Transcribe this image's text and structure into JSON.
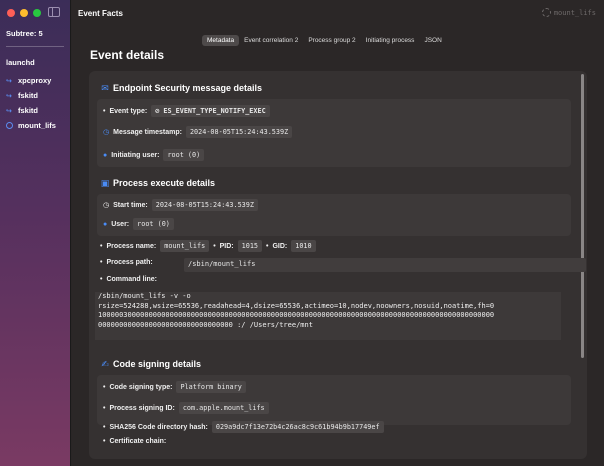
{
  "sidebar": {
    "subtree_label": "Subtree: 5",
    "root": "launchd",
    "items": [
      {
        "label": "xpcproxy",
        "icon": "arrow-icon"
      },
      {
        "label": "fskitd",
        "icon": "arrow-icon"
      },
      {
        "label": "fskitd",
        "icon": "arrow-icon"
      },
      {
        "label": "mount_lifs",
        "icon": "circle-icon"
      }
    ]
  },
  "window": {
    "title": "Event Facts",
    "titlebar_right": "mount_lifs"
  },
  "tabs": [
    {
      "label": "Metadata",
      "active": true
    },
    {
      "label": "Event correlation 2",
      "active": false
    },
    {
      "label": "Process group 2",
      "active": false
    },
    {
      "label": "Initiating process",
      "active": false
    },
    {
      "label": "JSON",
      "active": false
    }
  ],
  "page_title": "Event details",
  "es_section": {
    "title": "Endpoint Security message details",
    "event_type_label": "Event type:",
    "event_type_value": "ES_EVENT_TYPE_NOTIFY_EXEC",
    "timestamp_label": "Message timestamp:",
    "timestamp_value": "2024-08-05T15:24:43.539Z",
    "user_label": "Initiating user:",
    "user_value": "root (0)"
  },
  "proc_section": {
    "title": "Process execute details",
    "start_label": "Start time:",
    "start_value": "2024-08-05T15:24:43.539Z",
    "user_label": "User:",
    "user_value": "root (0)",
    "name_label": "Process name:",
    "name_value": "mount_lifs",
    "pid_label": "PID:",
    "pid_value": "1015",
    "gid_label": "GID:",
    "gid_value": "1010",
    "path_label": "Process path:",
    "path_value": "/sbin/mount_lifs",
    "cmd_label": "Command line:",
    "cmd_value": "/sbin/mount_lifs -v -o\nrsize=524288,wsize=65536,readahead=4,dsize=65536,actimeo=10,nodev,noowners,nosuid,noatime,fh=0\n1000003000000000000000000000000000000000000000000000000000000000000000000000000000000000000000\n00000000000000000000000000000000 :/ /Users/tree/mnt"
  },
  "cs_section": {
    "title": "Code signing details",
    "type_label": "Code signing type:",
    "type_value": "Platform binary",
    "id_label": "Process signing ID:",
    "id_value": "com.apple.mount_lifs",
    "hash_label": "SHA256 Code directory hash:",
    "hash_value": "029a9dc7f13e72b4c26ac8c9c61b94b9b17749ef",
    "chain_label": "Certificate chain:"
  }
}
